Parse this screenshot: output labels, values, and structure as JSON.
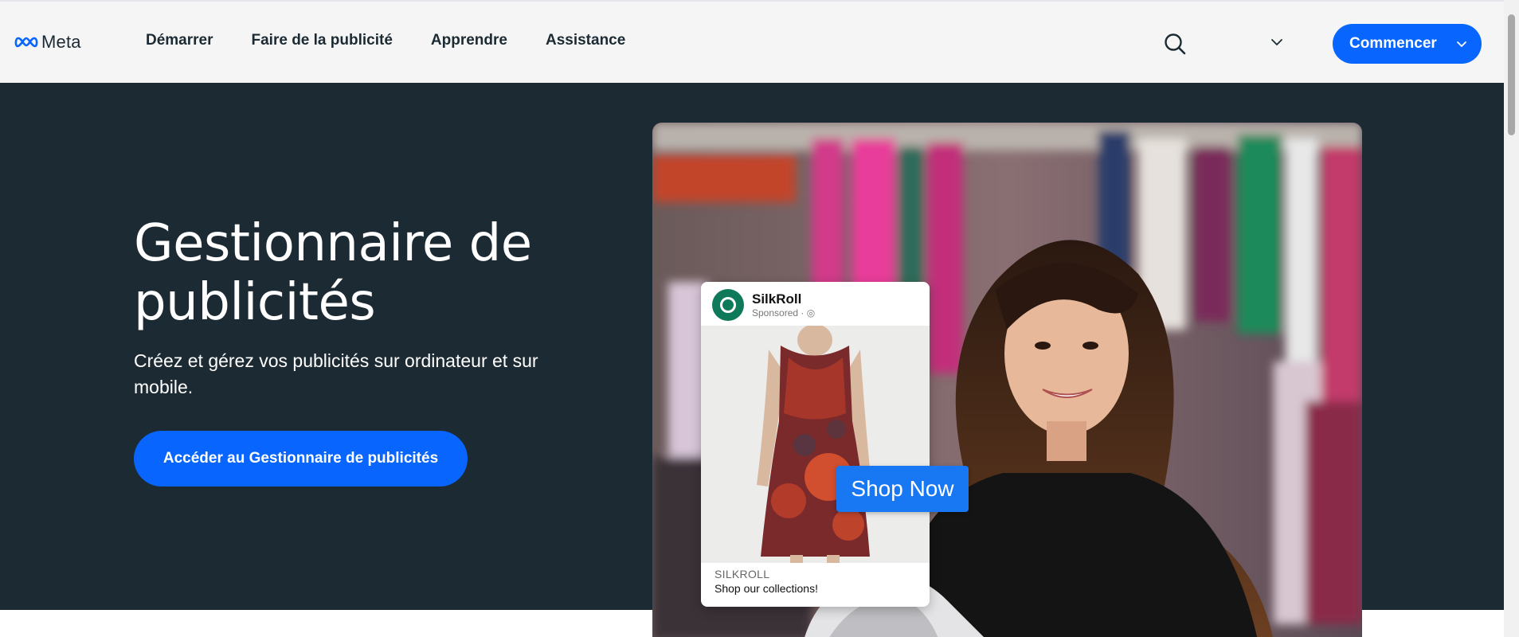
{
  "brand": {
    "name": "Meta",
    "logo_icon": "meta-infinity-logo"
  },
  "nav": {
    "items": [
      {
        "label": "Démarrer"
      },
      {
        "label": "Faire de la publicité"
      },
      {
        "label": "Apprendre"
      },
      {
        "label": "Assistance"
      }
    ],
    "search_icon": "search-icon",
    "language_icon": "chevron-down-icon",
    "cta_label": "Commencer"
  },
  "hero": {
    "title": "Gestionnaire de publicités",
    "subtitle": "Créez et gérez vos publicités sur ordinateur et sur mobile.",
    "cta_label": "Accéder au Gestionnaire de publicités"
  },
  "ad_preview": {
    "brand": "SilkRoll",
    "sponsored": "Sponsored · ◎",
    "footer_brand": "SILKROLL",
    "footer_tagline": "Shop our collections!",
    "button_label": "Shop Now"
  },
  "colors": {
    "accent": "#0866ff",
    "hero_bg": "#1c2b33",
    "nav_bg": "#f5f5f5",
    "shop_button": "#1877f2"
  }
}
